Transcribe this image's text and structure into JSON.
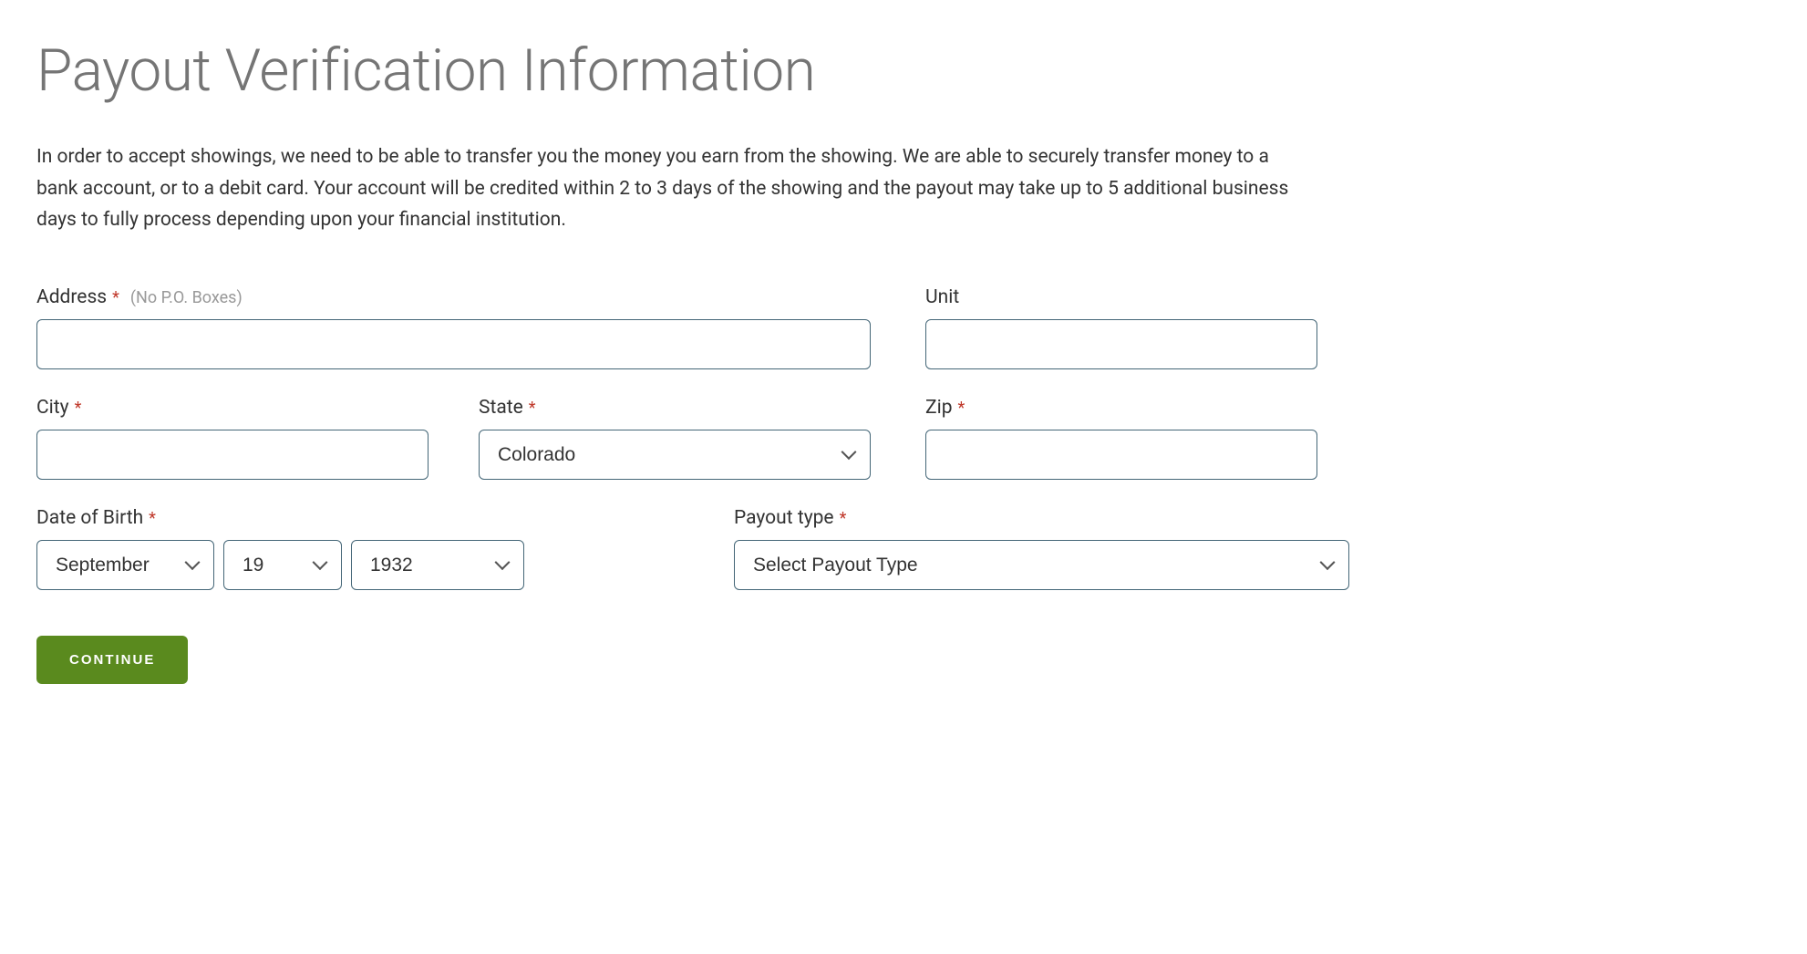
{
  "page": {
    "title": "Payout Verification Information",
    "description": "In order to accept showings, we need to be able to transfer you the money you earn from the showing. We are able to securely transfer money to a bank account, or to a debit card. Your account will be credited within 2 to 3 days of the showing and the payout may take up to 5 additional business days to fully process depending upon your financial institution."
  },
  "form": {
    "address": {
      "label": "Address",
      "hint": "(No P.O. Boxes)",
      "value": ""
    },
    "unit": {
      "label": "Unit",
      "value": ""
    },
    "city": {
      "label": "City",
      "value": ""
    },
    "state": {
      "label": "State",
      "value": "Colorado"
    },
    "zip": {
      "label": "Zip",
      "value": ""
    },
    "dob": {
      "label": "Date of Birth",
      "month": "September",
      "day": "19",
      "year": "1932"
    },
    "payout": {
      "label": "Payout type",
      "value": "Select Payout Type"
    },
    "required_marker": "*",
    "continue_label": "CONTINUE"
  }
}
